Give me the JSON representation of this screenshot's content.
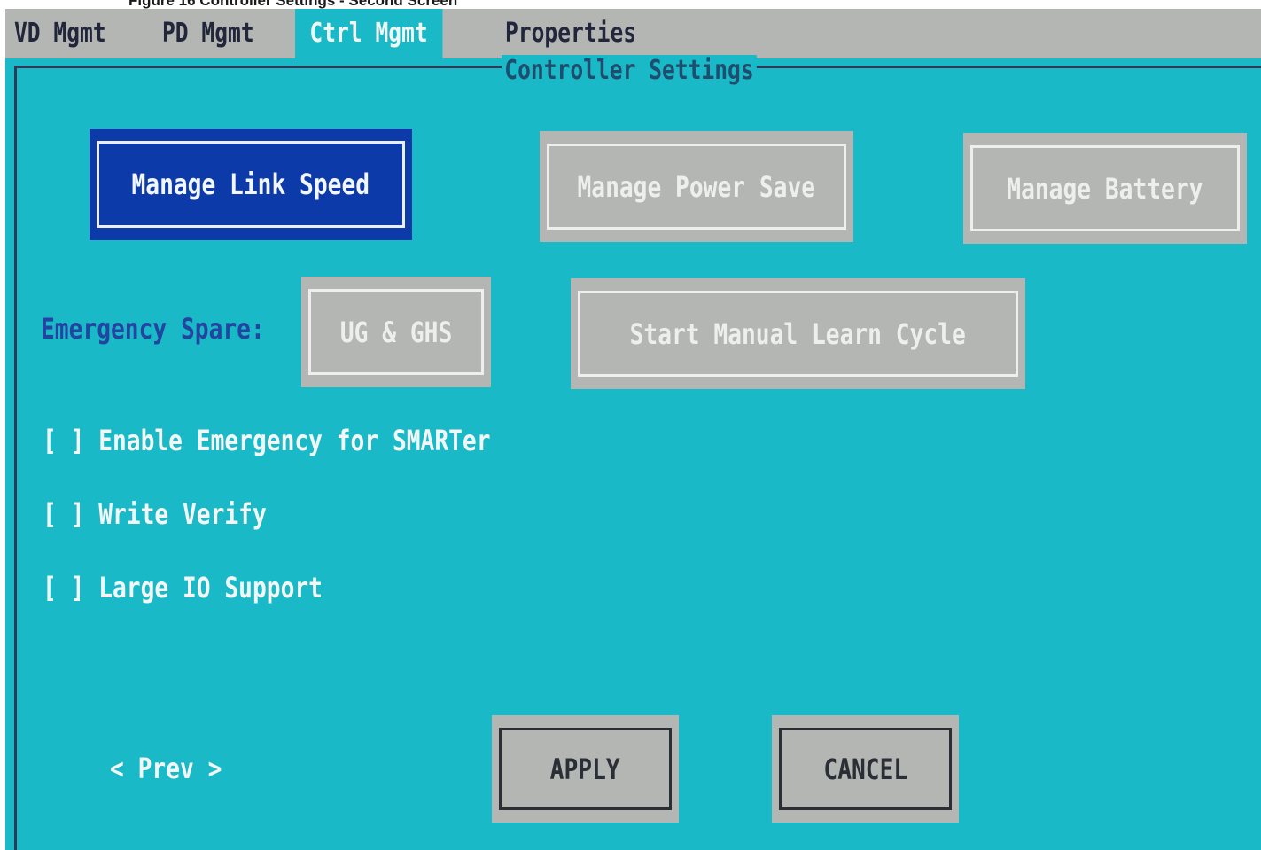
{
  "caption": "Figure 16 Controller Settings - Second Screen",
  "menu": {
    "tabs": [
      {
        "label": "VD Mgmt"
      },
      {
        "label": "PD Mgmt"
      },
      {
        "label": "Ctrl Mgmt"
      },
      {
        "label": "Properties"
      }
    ],
    "active_tab": "Ctrl Mgmt"
  },
  "panel": {
    "title": "Controller Settings"
  },
  "buttons": {
    "manage_link_speed": "Manage Link Speed",
    "manage_power_save": "Manage Power Save",
    "manage_battery": "Manage Battery",
    "emergency_spare_value": "UG & GHS",
    "start_manual_learn_cycle": "Start Manual Learn Cycle",
    "apply": "APPLY",
    "cancel": "CANCEL"
  },
  "emergency_spare_label": "Emergency Spare:",
  "checkboxes": [
    {
      "box": "[ ]",
      "label": "Enable Emergency for SMARTer",
      "checked": false
    },
    {
      "box": "[ ]",
      "label": "Write Verify",
      "checked": false
    },
    {
      "box": "[ ]",
      "label": "Large IO Support",
      "checked": false
    }
  ],
  "pager": "< Prev >",
  "colors": {
    "screen_bg": "#1ab9c7",
    "menubar_bg": "#b4b6b3",
    "focused_button": "#0d3aa9",
    "button_bg": "#b4b6b3"
  }
}
